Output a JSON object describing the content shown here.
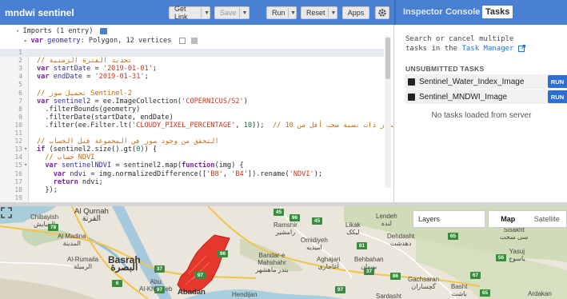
{
  "editor": {
    "script_name": "mndwi sentinel",
    "buttons": {
      "get_link": "Get Link",
      "save": "Save",
      "run": "Run",
      "reset": "Reset",
      "apps": "Apps"
    },
    "imports_header": "Imports (1 entry)",
    "imports_line": {
      "keyword": "var",
      "name": "geometry",
      "rest": ": Polygon, 12 vertices"
    },
    "lines": [
      {
        "n": "1",
        "active": true,
        "tokens": []
      },
      {
        "n": "2",
        "tokens": [
          {
            "c": "cm",
            "t": "// تحديد الفترة الزمنية"
          }
        ]
      },
      {
        "n": "3",
        "tokens": [
          {
            "c": "kw",
            "t": "var"
          },
          {
            "c": "var",
            "t": " startDate"
          },
          {
            "c": "fn",
            "t": " = "
          },
          {
            "c": "str",
            "t": "'2019-01-01'"
          },
          {
            "c": "fn",
            "t": ";"
          }
        ]
      },
      {
        "n": "4",
        "tokens": [
          {
            "c": "kw",
            "t": "var"
          },
          {
            "c": "var",
            "t": " endDate"
          },
          {
            "c": "fn",
            "t": " = "
          },
          {
            "c": "str",
            "t": "'2019-01-31'"
          },
          {
            "c": "fn",
            "t": ";"
          }
        ]
      },
      {
        "n": "5",
        "tokens": []
      },
      {
        "n": "6",
        "tokens": [
          {
            "c": "cm",
            "t": "// تحميل صور Sentinel-2"
          }
        ]
      },
      {
        "n": "7",
        "tokens": [
          {
            "c": "kw",
            "t": "var"
          },
          {
            "c": "var",
            "t": " sentinel2"
          },
          {
            "c": "fn",
            "t": " = ee.ImageCollection("
          },
          {
            "c": "str",
            "t": "'COPERNICUS/S2'"
          },
          {
            "c": "fn",
            "t": ")"
          }
        ]
      },
      {
        "n": "8",
        "tokens": [
          {
            "c": "fn",
            "t": "  .filterBounds(geometry)"
          }
        ]
      },
      {
        "n": "9",
        "tokens": [
          {
            "c": "fn",
            "t": "  .filterDate(startDate, endDate)"
          }
        ]
      },
      {
        "n": "10",
        "tokens": [
          {
            "c": "fn",
            "t": "  .filter(ee.Filter.lt("
          },
          {
            "c": "str",
            "t": "'CLOUDY_PIXEL_PERCENTAGE'"
          },
          {
            "c": "fn",
            "t": ", "
          },
          {
            "c": "num-lit",
            "t": "10"
          },
          {
            "c": "fn",
            "t": "));  "
          },
          {
            "c": "cm",
            "t": "// تصفية الصور ذات نسبة سحب أقل من 10%"
          }
        ]
      },
      {
        "n": "11",
        "tokens": []
      },
      {
        "n": "12",
        "tokens": [
          {
            "c": "cm",
            "t": "// التحقق من وجود صور في المجموعة قبل الحساب"
          }
        ]
      },
      {
        "n": "13",
        "fold": true,
        "tokens": [
          {
            "c": "kw",
            "t": "if"
          },
          {
            "c": "fn",
            "t": " (sentinel2.size().gt("
          },
          {
            "c": "num-lit",
            "t": "0"
          },
          {
            "c": "fn",
            "t": ")) {"
          }
        ]
      },
      {
        "n": "14",
        "tokens": [
          {
            "c": "cm",
            "t": "  // حساب NDVI"
          }
        ]
      },
      {
        "n": "15",
        "fold": true,
        "tokens": [
          {
            "c": "kw",
            "t": "  var"
          },
          {
            "c": "var",
            "t": " sentinelNDVI"
          },
          {
            "c": "fn",
            "t": " = sentinel2.map("
          },
          {
            "c": "kw",
            "t": "function"
          },
          {
            "c": "fn",
            "t": "(img) {"
          }
        ]
      },
      {
        "n": "16",
        "tokens": [
          {
            "c": "kw",
            "t": "    var"
          },
          {
            "c": "var",
            "t": " ndvi"
          },
          {
            "c": "fn",
            "t": " = img.normalizedDifference(["
          },
          {
            "c": "str",
            "t": "'B8'"
          },
          {
            "c": "fn",
            "t": ", "
          },
          {
            "c": "str",
            "t": "'B4'"
          },
          {
            "c": "fn",
            "t": "]).rename("
          },
          {
            "c": "str",
            "t": "'NDVI'"
          },
          {
            "c": "fn",
            "t": ");"
          }
        ]
      },
      {
        "n": "17",
        "tokens": [
          {
            "c": "kw",
            "t": "    return"
          },
          {
            "c": "fn",
            "t": " ndvi;"
          }
        ]
      },
      {
        "n": "18",
        "tokens": [
          {
            "c": "fn",
            "t": "  });"
          }
        ]
      },
      {
        "n": "19",
        "tokens": []
      }
    ]
  },
  "right_panel": {
    "tabs": {
      "inspector": "Inspector",
      "console": "Console",
      "tasks": "Tasks"
    },
    "description_1": "Search or cancel multiple",
    "description_2": "tasks in the ",
    "task_manager_link": "Task Manager",
    "section_title": "UNSUBMITTED TASKS",
    "tasks": [
      {
        "name": "Sentinel_Water_Index_Image",
        "run": "RUN"
      },
      {
        "name": "Sentinel_MNDWI_Image",
        "run": "RUN"
      }
    ],
    "empty_text": "No tasks loaded from server"
  },
  "map": {
    "controls": {
      "layers": "Layers",
      "map": "Map",
      "satellite": "Satellite"
    },
    "polygon_color": "#e3241b",
    "labels": [
      {
        "t": "Al Qurnah",
        "a": "القرنة"
      },
      {
        "t": "Chibayish",
        "a": "الجبايش"
      },
      {
        "t": "Al Madina",
        "a": "المدينة"
      },
      {
        "t": "Al-Rumaila",
        "a": "الرميلة"
      },
      {
        "t": "Basrah",
        "a": "البصرة"
      },
      {
        "t": "Abu",
        "a": "Al-Khaseeb"
      },
      {
        "t": "Abadan",
        "a": "أبو الخصيب"
      },
      {
        "t": "Ramshir",
        "a": "رامشیر"
      },
      {
        "t": "Likak",
        "a": "لیکک"
      },
      {
        "t": "Omidiyeh",
        "a": "امیدیه"
      },
      {
        "t": "Bandar-e Mahshahr",
        "a": "بندر ماهشهر"
      },
      {
        "t": "Aghajari",
        "a": "آغاجاری"
      },
      {
        "t": "Behbahan",
        "a": "بهبهان"
      },
      {
        "t": "Dehdasht",
        "a": "دهدشت"
      },
      {
        "t": "Lendeh",
        "a": "لنده"
      },
      {
        "t": "Sisakht",
        "a": "سی سخت"
      },
      {
        "t": "Yasuj",
        "a": "یاسوج"
      },
      {
        "t": "Gachsaran",
        "a": "گچساران"
      },
      {
        "t": "Basht",
        "a": "باشت"
      },
      {
        "t": "Ardakan",
        "a": ""
      },
      {
        "t": "Sardasht",
        "a": ""
      },
      {
        "t": "Hendijan",
        "a": ""
      },
      {
        "t": "Gachsaran",
        "a": ""
      }
    ],
    "shields": [
      "45",
      "96",
      "78",
      "96",
      "37",
      "97",
      "6",
      "97",
      "97",
      "81",
      "37",
      "86",
      "65",
      "56",
      "67",
      "45",
      "65"
    ]
  }
}
